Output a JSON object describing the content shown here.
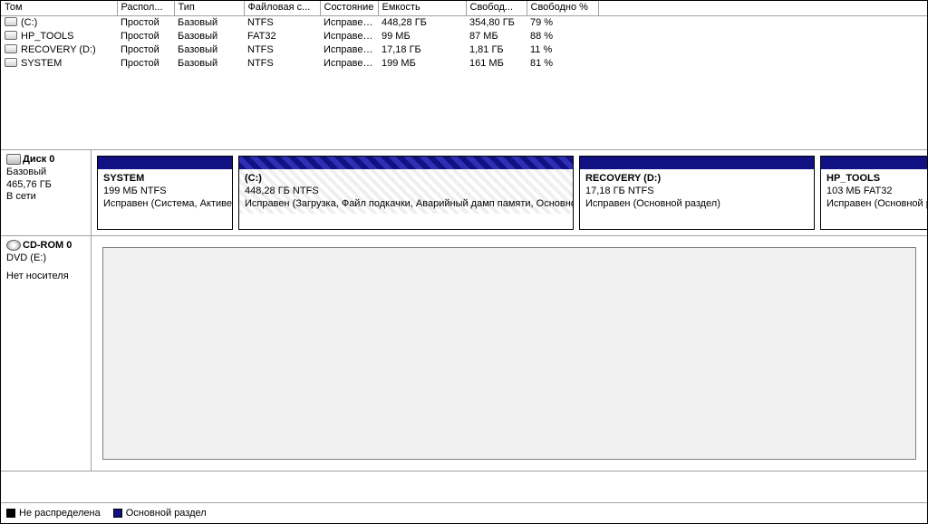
{
  "columns": {
    "volume": "Том",
    "layout": "Распол...",
    "type": "Тип",
    "fs": "Файловая с...",
    "status": "Состояние",
    "capacity": "Емкость",
    "free": "Свобод...",
    "free_pct": "Свободно %"
  },
  "volumes": [
    {
      "name": "(C:)",
      "layout": "Простой",
      "type": "Базовый",
      "fs": "NTFS",
      "status": "Исправен...",
      "capacity": "448,28 ГБ",
      "free": "354,80 ГБ",
      "free_pct": "79 %"
    },
    {
      "name": "HP_TOOLS",
      "layout": "Простой",
      "type": "Базовый",
      "fs": "FAT32",
      "status": "Исправен...",
      "capacity": "99 МБ",
      "free": "87 МБ",
      "free_pct": "88 %"
    },
    {
      "name": "RECOVERY (D:)",
      "layout": "Простой",
      "type": "Базовый",
      "fs": "NTFS",
      "status": "Исправен...",
      "capacity": "17,18 ГБ",
      "free": "1,81 ГБ",
      "free_pct": "11 %"
    },
    {
      "name": "SYSTEM",
      "layout": "Простой",
      "type": "Базовый",
      "fs": "NTFS",
      "status": "Исправен...",
      "capacity": "199 МБ",
      "free": "161 МБ",
      "free_pct": "81 %"
    }
  ],
  "disk0": {
    "name": "Диск 0",
    "type": "Базовый",
    "size": "465,76 ГБ",
    "status": "В сети",
    "partitions": [
      {
        "label": "SYSTEM",
        "detail": "199 МБ NTFS",
        "status": "Исправен (Система, Активен)",
        "selected": false
      },
      {
        "label": "(C:)",
        "detail": "448,28 ГБ NTFS",
        "status": "Исправен (Загрузка, Файл подкачки, Аварийный дамп памяти, Основной раздел)",
        "selected": true
      },
      {
        "label": "RECOVERY  (D:)",
        "detail": "17,18 ГБ NTFS",
        "status": "Исправен (Основной раздел)",
        "selected": false
      },
      {
        "label": "HP_TOOLS",
        "detail": "103 МБ FAT32",
        "status": "Исправен (Основной раздел)",
        "selected": false
      }
    ]
  },
  "cdrom": {
    "name": "CD-ROM 0",
    "drive": "DVD (E:)",
    "status": "Нет носителя"
  },
  "legend": {
    "unallocated": "Не распределена",
    "primary": "Основной раздел"
  }
}
